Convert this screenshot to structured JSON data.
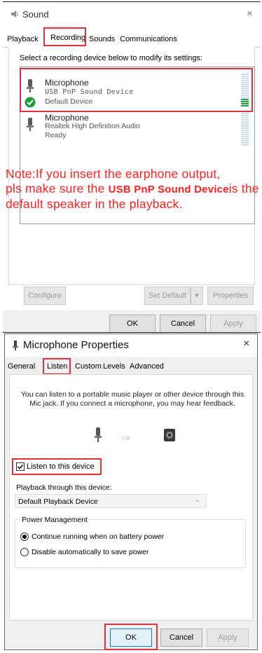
{
  "sound": {
    "title": "Sound",
    "tabs": [
      "Playback",
      "Recording",
      "Sounds",
      "Communications"
    ],
    "instruction": "Select a recording device below to modify its settings:",
    "devices": [
      {
        "name": "Microphone",
        "desc": "USB PnP Sound Device",
        "status": "Default Device",
        "level_fraction": 0.25
      },
      {
        "name": "Microphone",
        "desc": "Realtek High Definition Audio",
        "status": "Ready",
        "level_fraction": 0.0
      }
    ],
    "note_part1": "Note:If you insert the earphone output,",
    "note_part2": "pls make sure the",
    "note_bold": "USB PnP Sound Device",
    "note_part3": "is the",
    "note_part4": "default speaker in the playback.",
    "buttons": {
      "configure": "Configure",
      "set_default": "Set Default",
      "properties": "Properties",
      "ok": "OK",
      "cancel": "Cancel",
      "apply": "Apply"
    }
  },
  "mic": {
    "title": "Microphone Properties",
    "tabs": [
      "General",
      "Listen",
      "Custom",
      "Levels",
      "Advanced"
    ],
    "description": "You can listen to a portable music player or other device through this Mic jack.  If you connect a microphone, you may hear feedback.",
    "listen_checkbox": "Listen to this device",
    "listen_checked": true,
    "playback_label": "Playback through this device:",
    "playback_value": "Default Playback Device",
    "power_group": "Power Management",
    "radio1": "Continue running when on battery power",
    "radio2": "Disable automatically to save power",
    "buttons": {
      "ok": "OK",
      "cancel": "Cancel",
      "apply": "Apply"
    }
  },
  "colors": {
    "accent_red": "#e0303a",
    "note_red": "#ff2020",
    "level_green": "#20a040"
  }
}
